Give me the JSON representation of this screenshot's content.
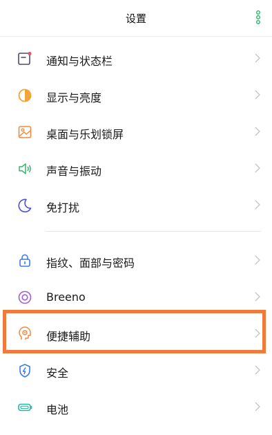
{
  "header": {
    "title": "设置",
    "more_icon": "more-vertical-icon"
  },
  "items": [
    {
      "label": "通知与状态栏",
      "icon": "notification-icon",
      "color": "#e0566a"
    },
    {
      "label": "显示与亮度",
      "icon": "brightness-icon",
      "color": "#f2a33a"
    },
    {
      "label": "桌面与乐划锁屏",
      "icon": "wallpaper-icon",
      "color": "#ef8a3d"
    },
    {
      "label": "声音与振动",
      "icon": "sound-icon",
      "color": "#39b36a"
    },
    {
      "label": "免打扰",
      "icon": "moon-icon",
      "color": "#4a4fd6"
    },
    {
      "label": "指纹、面部与密码",
      "icon": "lock-icon",
      "color": "#3b7be8"
    },
    {
      "label": "Breeno",
      "icon": "breeno-icon",
      "color": "#a45bd8"
    },
    {
      "label": "便捷辅助",
      "icon": "assist-icon",
      "color": "#ef8a3d"
    },
    {
      "label": "安全",
      "icon": "shield-icon",
      "color": "#3b7be8"
    },
    {
      "label": "电池",
      "icon": "battery-icon",
      "color": "#20b8a8"
    }
  ],
  "colors": {
    "accent_green": "#20b86a",
    "highlight": "#f07a3c",
    "chevron": "#c4c4c4"
  }
}
